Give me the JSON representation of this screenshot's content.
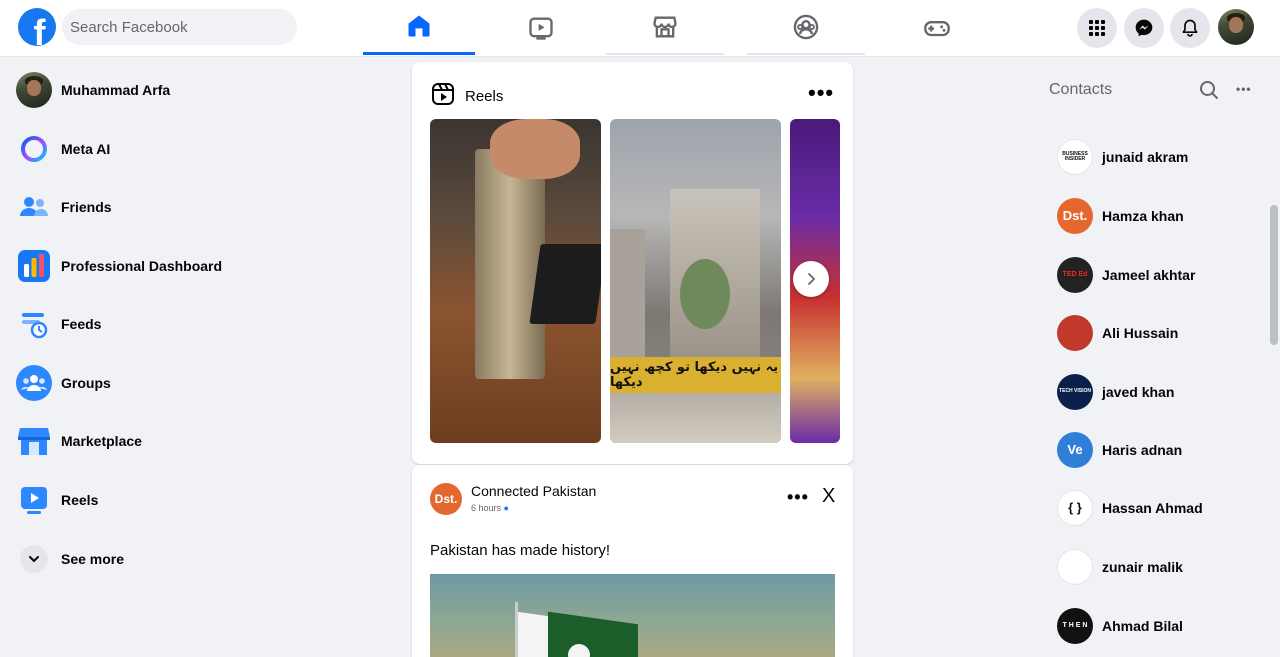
{
  "search": {
    "placeholder": "Search Facebook"
  },
  "nav": {
    "tabs": [
      {
        "icon": "home-icon",
        "active": true
      },
      {
        "icon": "video-icon",
        "active": false
      },
      {
        "icon": "marketplace-icon",
        "active": false
      },
      {
        "icon": "groups-icon",
        "active": false
      },
      {
        "icon": "gaming-icon",
        "active": false
      }
    ]
  },
  "sidebar": {
    "items": [
      {
        "label": "Muhammad Arfa",
        "icon": "profile-avatar"
      },
      {
        "label": "Meta AI",
        "icon": "meta-ai-icon"
      },
      {
        "label": "Friends",
        "icon": "friends-icon"
      },
      {
        "label": "Professional Dashboard",
        "icon": "dashboard-icon"
      },
      {
        "label": "Feeds",
        "icon": "feeds-icon"
      },
      {
        "label": "Groups",
        "icon": "groups-icon"
      },
      {
        "label": "Marketplace",
        "icon": "marketplace-icon"
      },
      {
        "label": "Reels",
        "icon": "reels-icon"
      },
      {
        "label": "See more",
        "icon": "chevron-down-icon"
      }
    ]
  },
  "reels": {
    "title": "Reels",
    "urdu_caption": "یہ نہیں دیکھا تو کچھ نہیں دیکھا"
  },
  "post": {
    "author": "Connected Pakistan",
    "author_logo": "Dst.",
    "time": "6 hours",
    "text": "Pakistan has made history!",
    "close_label": "X"
  },
  "contacts": {
    "title": "Contacts",
    "items": [
      {
        "name": "junaid akram",
        "logo": "BUSINESS INSIDER",
        "bg": "#ffffff",
        "fg": "#111111"
      },
      {
        "name": "Hamza khan",
        "logo": "Dst.",
        "bg": "#e4672f",
        "fg": "#ffffff"
      },
      {
        "name": "Jameel akhtar",
        "logo": "TED Ed",
        "bg": "#222222",
        "fg": "#e62b1e"
      },
      {
        "name": "Ali Hussain",
        "logo": "",
        "bg": "#c0392b",
        "fg": "#ffffff"
      },
      {
        "name": "javed khan",
        "logo": "TECH VISION",
        "bg": "#0b1f4d",
        "fg": "#ffffff"
      },
      {
        "name": "Haris adnan",
        "logo": "Ve",
        "bg": "#2f7fd8",
        "fg": "#ffffff"
      },
      {
        "name": "Hassan Ahmad",
        "logo": "{ }",
        "bg": "#ffffff",
        "fg": "#111111"
      },
      {
        "name": "zunair malik",
        "logo": "",
        "bg": "#ffffff",
        "fg": "#2aa8d8"
      },
      {
        "name": "Ahmad Bilal",
        "logo": "T H E N",
        "bg": "#111111",
        "fg": "#ffffff"
      }
    ]
  },
  "colors": {
    "brand": "#1877f2",
    "active_tab": "#0866ff",
    "bg": "#f0f2f5"
  }
}
